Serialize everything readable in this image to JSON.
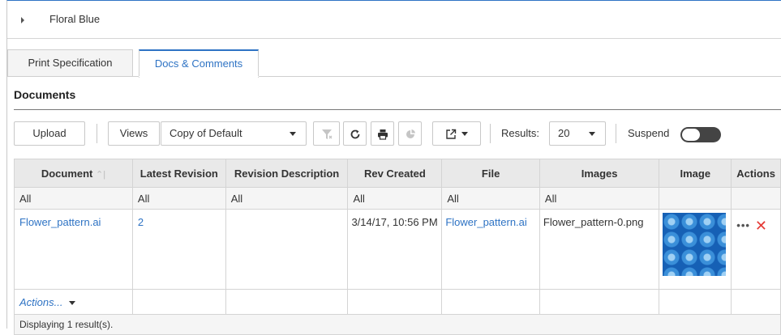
{
  "header": {
    "title": "Floral Blue"
  },
  "tabs": [
    {
      "label": "Print Specification"
    },
    {
      "label": "Docs & Comments"
    }
  ],
  "section": {
    "title": "Documents"
  },
  "toolbar": {
    "upload_label": "Upload",
    "views_label": "Views",
    "view_select_value": "Copy of Default",
    "results_label": "Results:",
    "results_value": "20",
    "suspend_label": "Suspend"
  },
  "table": {
    "columns": [
      "Document",
      "Latest Revision",
      "Revision Description",
      "Rev Created",
      "File",
      "Images",
      "Image",
      "Actions"
    ],
    "filters": [
      "All",
      "All",
      "All",
      "All",
      "All",
      "All"
    ],
    "rows": [
      {
        "document": "Flower_pattern.ai",
        "latest_revision": "2",
        "revision_description": "",
        "rev_created": "3/14/17, 10:56 PM",
        "file": "Flower_pattern.ai",
        "images": "Flower_pattern-0.png"
      }
    ],
    "actions_menu_label": "Actions...",
    "footer": "Displaying 1 result(s)."
  }
}
